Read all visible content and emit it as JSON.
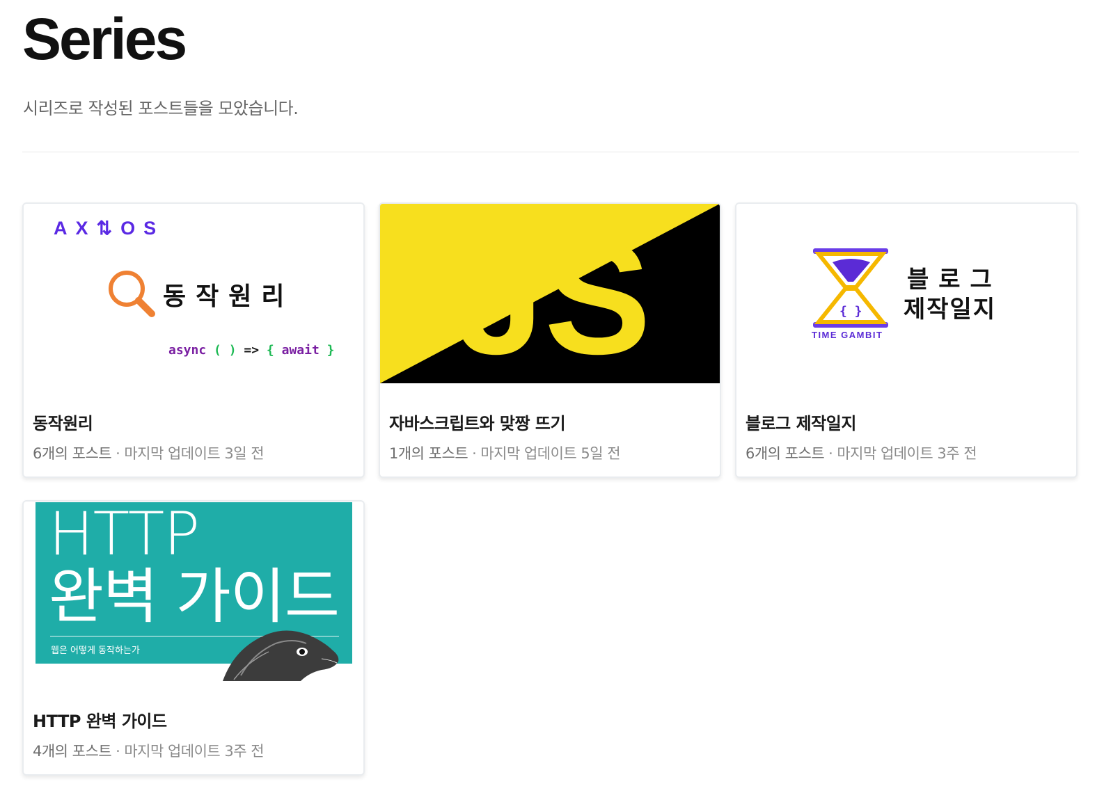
{
  "header": {
    "title": "Series",
    "description": "시리즈로 작성된 포스트들을 모았습니다."
  },
  "series": [
    {
      "title": "동작원리",
      "count": "6개의 포스트",
      "separator": "·",
      "updated": "마지막 업데이트 3일 전",
      "thumb": {
        "logo": "AX⇅OS",
        "heading": "동작원리",
        "code_async": "async",
        "code_paren": "( )",
        "code_arrow": "=>",
        "code_open": "{",
        "code_await": "await",
        "code_close": "}",
        "accent": "#5a29e4",
        "icon": "magnifier-icon"
      }
    },
    {
      "title": "자바스크립트와 맞짱 뜨기",
      "count": "1개의 포스트",
      "separator": "·",
      "updated": "마지막 업데이트 5일 전",
      "thumb": {
        "text": "JS",
        "bg_yellow": "#f7df1e",
        "bg_black": "#000000"
      }
    },
    {
      "title": "블로그 제작일지",
      "count": "6개의 포스트",
      "separator": "·",
      "updated": "마지막 업데이트 3주 전",
      "thumb": {
        "line1": "블로그",
        "line2": "제작일지",
        "logo_text": "TIME GAMBIT",
        "braces": "{ }",
        "icon": "hourglass-icon"
      }
    },
    {
      "title": "HTTP 완벽 가이드",
      "count": "4개의 포스트",
      "separator": "·",
      "updated": "마지막 업데이트 3주 전",
      "thumb": {
        "line1": "HTTP",
        "line2": "완벽 가이드",
        "subtitle": "웹은 어떻게 동작하는가",
        "bg": "#1fada8"
      }
    }
  ]
}
